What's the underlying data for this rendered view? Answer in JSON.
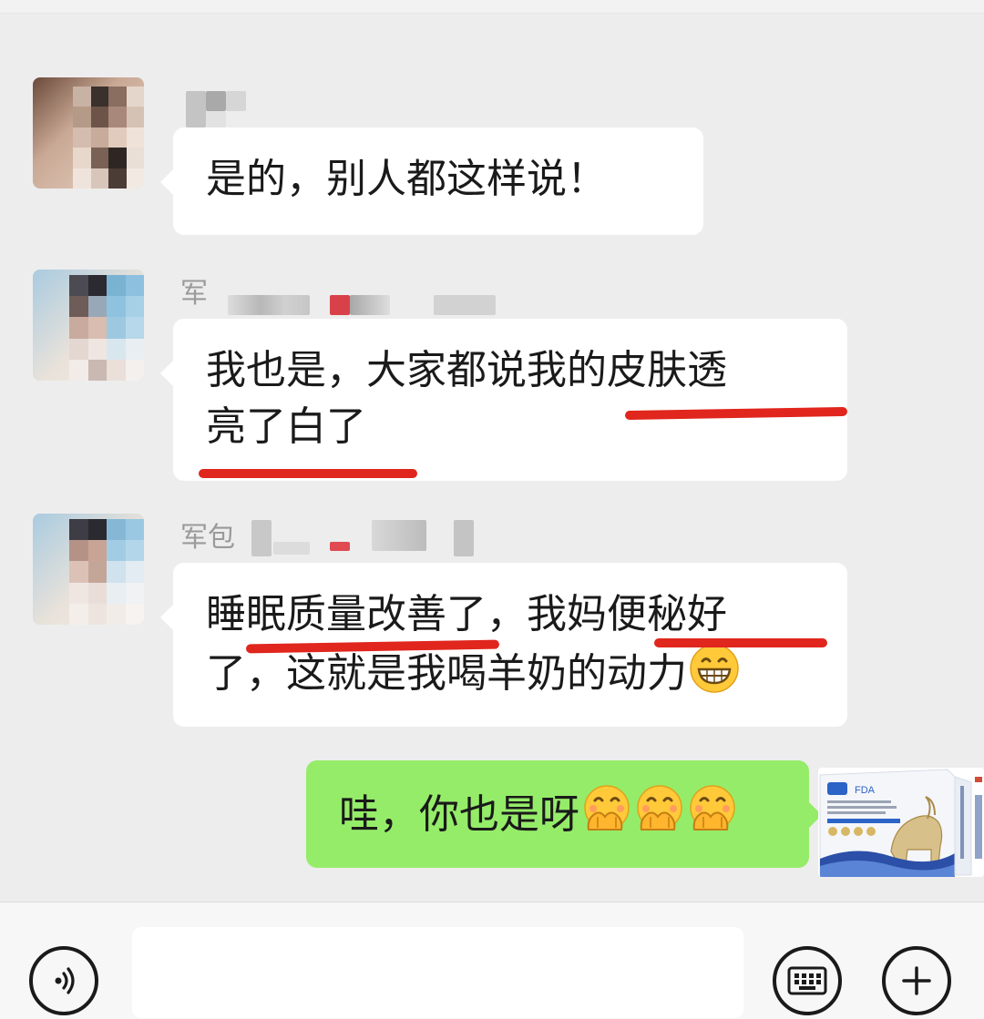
{
  "messages": [
    {
      "sender": "other",
      "name_visible": "",
      "text": "是的，别人都这样说！"
    },
    {
      "sender": "other",
      "name_visible": "军",
      "text_line1": "我也是，大家都说我的皮肤透",
      "text_line2": "亮了白了"
    },
    {
      "sender": "other",
      "name_visible": "军包",
      "text_line1": "睡眠质量改善了，我妈便秘好",
      "text_line2": "了，这就是我喝羊奶的动力",
      "emoji": "grinning-face-icon"
    },
    {
      "sender": "me",
      "text": "哇，你也是呀",
      "emojis": [
        "hand-over-mouth-icon",
        "hand-over-mouth-icon",
        "hand-over-mouth-icon"
      ]
    }
  ],
  "product_image": {
    "label": "FDA"
  },
  "input_bar": {
    "left_icon": "voice-icon",
    "input_value": "",
    "right_icons": [
      "keyboard-icon",
      "plus-icon"
    ]
  },
  "colors": {
    "underline": "#e0261d",
    "my_bubble": "#95ec69",
    "background": "#ededed"
  }
}
